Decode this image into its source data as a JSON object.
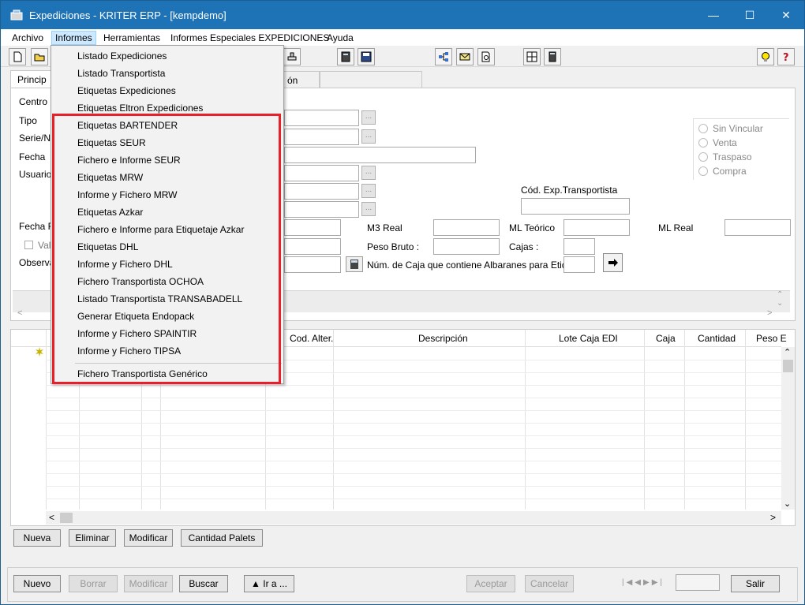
{
  "window": {
    "title": "Expediciones - KRITER ERP - [kempdemo]",
    "controls": {
      "minimize": "—",
      "maximize": "☐",
      "close": "✕"
    }
  },
  "menubar": [
    "Archivo",
    "Informes",
    "Herramientas",
    "Informes Especiales EXPEDICIONES",
    "Ayuda"
  ],
  "tabs": {
    "principal": "Princip",
    "other": "ón"
  },
  "form": {
    "labels": {
      "centro": "Centro",
      "tipo": "Tipo",
      "serie": "Serie/Nu",
      "fecha": "Fecha",
      "usuario": "Usuario",
      "fecha_r": "Fecha R",
      "val": "Val",
      "observ": "Observa",
      "cod_exp": "Cód. Exp.Transportista",
      "m3_real": "M3 Real",
      "ml_teorico": "ML Teórico",
      "ml_real": "ML Real",
      "peso_bruto": "Peso Bruto :",
      "cajas": "Cajas :",
      "num_caja": "Núm. de Caja que contiene Albaranes para Etiquetas"
    },
    "radios": [
      "Sin Vincular",
      "Venta",
      "Traspaso",
      "Compra"
    ],
    "ellipsis": "..."
  },
  "grid": {
    "columns": [
      "Cod. Alter.",
      "Descripción",
      "Lote Caja EDI",
      "Caja",
      "Cantidad",
      "Peso E"
    ]
  },
  "row_buttons": {
    "nueva": "Nueva",
    "eliminar": "Eliminar",
    "modificar": "Modificar",
    "cantidad_palets": "Cantidad Palets"
  },
  "footer_buttons": {
    "nuevo": "Nuevo",
    "borrar": "Borrar",
    "modificar": "Modificar",
    "buscar": "Buscar",
    "ir_a": "▲  Ir a ...",
    "aceptar": "Aceptar",
    "cancelar": "Cancelar",
    "salir": "Salir"
  },
  "informes_menu": {
    "items_top": [
      "Listado Expediciones",
      "Listado Transportista",
      "Etiquetas Expediciones",
      "Etiquetas Eltron Expediciones"
    ],
    "items_highlighted": [
      "Etiquetas BARTENDER",
      "Etiquetas SEUR",
      "Fichero e Informe SEUR",
      "Etiquetas MRW",
      "Informe y Fichero MRW",
      "Etiquetas Azkar",
      "Fichero e Informe para Etiquetaje Azkar",
      "Etiquetas DHL",
      "Informe y Fichero DHL",
      "Fichero Transportista OCHOA",
      "Listado Transportista TRANSABADELL",
      "Generar Etiqueta Endopack",
      "Informe y Fichero SPAINTIR",
      "Informe y Fichero TIPSA"
    ],
    "item_last": "Fichero Transportista Genérico"
  },
  "colors": {
    "titlebar": "#1e73b7",
    "highlight": "#e8202a",
    "menu_active": "#cce8ff"
  }
}
